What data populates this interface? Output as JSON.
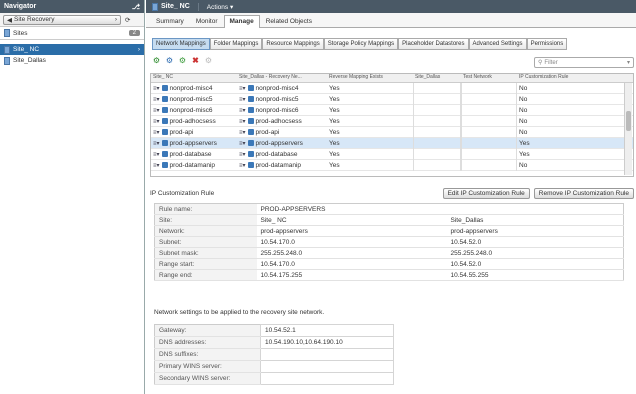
{
  "navigator": {
    "title": "Navigator",
    "pin_icon": "pin-icon",
    "back_label": "Site Recovery",
    "sites_label": "Sites",
    "sites_count": "2",
    "items": [
      {
        "label": "Site_ NC",
        "selected": true
      },
      {
        "label": "Site_Dallas",
        "selected": false
      }
    ]
  },
  "header": {
    "title": "Site_ NC",
    "actions_label": "Actions"
  },
  "top_tabs": [
    {
      "label": "Summary",
      "active": false
    },
    {
      "label": "Monitor",
      "active": false
    },
    {
      "label": "Manage",
      "active": true
    },
    {
      "label": "Related Objects",
      "active": false
    }
  ],
  "sub_tabs": [
    {
      "label": "Network Mappings",
      "active": true
    },
    {
      "label": "Folder Mappings",
      "active": false
    },
    {
      "label": "Resource Mappings",
      "active": false
    },
    {
      "label": "Storage Policy Mappings",
      "active": false
    },
    {
      "label": "Placeholder Datastores",
      "active": false
    },
    {
      "label": "Advanced Settings",
      "active": false
    },
    {
      "label": "Permissions",
      "active": false
    }
  ],
  "filter": {
    "placeholder": "Filter"
  },
  "grid": {
    "columns": [
      "Site_ NC",
      "Site_Dallas    - Recovery Ne...",
      "Reverse Mapping Exists",
      "Site_Dallas",
      "Test Network",
      "IP Customization Rule"
    ],
    "rows": [
      {
        "src": "nonprod-misc4",
        "dst": "nonprod-misc4",
        "reverse": "Yes",
        "dallas": "",
        "test": "",
        "ip": "No",
        "selected": false
      },
      {
        "src": "nonprod-misc5",
        "dst": "nonprod-misc5",
        "reverse": "Yes",
        "dallas": "",
        "test": "",
        "ip": "No",
        "selected": false
      },
      {
        "src": "nonprod-misc6",
        "dst": "nonprod-misc6",
        "reverse": "Yes",
        "dallas": "",
        "test": "",
        "ip": "No",
        "selected": false
      },
      {
        "src": "prod-adhocsess",
        "dst": "prod-adhocsess",
        "reverse": "Yes",
        "dallas": "",
        "test": "",
        "ip": "No",
        "selected": false
      },
      {
        "src": "prod-api",
        "dst": "prod-api",
        "reverse": "Yes",
        "dallas": "",
        "test": "",
        "ip": "No",
        "selected": false
      },
      {
        "src": "prod-appservers",
        "dst": "prod-appservers",
        "reverse": "Yes",
        "dallas": "",
        "test": "",
        "ip": "Yes",
        "selected": true
      },
      {
        "src": "prod-database",
        "dst": "prod-database",
        "reverse": "Yes",
        "dallas": "",
        "test": "",
        "ip": "Yes",
        "selected": false
      },
      {
        "src": "prod-datamanip",
        "dst": "prod-datamanip",
        "reverse": "Yes",
        "dallas": "",
        "test": "",
        "ip": "No",
        "selected": false
      }
    ]
  },
  "rule": {
    "title": "IP Customization Rule",
    "edit_label": "Edit IP Customization Rule",
    "remove_label": "Remove IP Customization Rule",
    "rows": [
      {
        "key": "Rule name:",
        "v1": "PROD-APPSERVERS",
        "v2": ""
      },
      {
        "key": "Site:",
        "v1": "Site_ NC",
        "v2": "Site_Dallas"
      },
      {
        "key": "Network:",
        "v1": "prod-appservers",
        "v2": "prod-appservers"
      },
      {
        "key": "Subnet:",
        "v1": "10.54.170.0",
        "v2": "10.54.52.0"
      },
      {
        "key": "Subnet mask:",
        "v1": "255.255.248.0",
        "v2": "255.255.248.0"
      },
      {
        "key": "Range start:",
        "v1": "10.54.170.0",
        "v2": "10.54.52.0"
      },
      {
        "key": "Range end:",
        "v1": "10.54.175.255",
        "v2": "10.54.55.255"
      }
    ]
  },
  "network_note": "Network settings to be applied to the recovery site network.",
  "network": [
    {
      "key": "Gateway:",
      "value": "10.54.52.1"
    },
    {
      "key": "DNS addresses:",
      "value": "10.54.190.10,10.64.190.10"
    },
    {
      "key": "DNS suffixes:",
      "value": ""
    },
    {
      "key": "Primary WINS server:",
      "value": ""
    },
    {
      "key": "Secondary WINS server:",
      "value": ""
    }
  ]
}
